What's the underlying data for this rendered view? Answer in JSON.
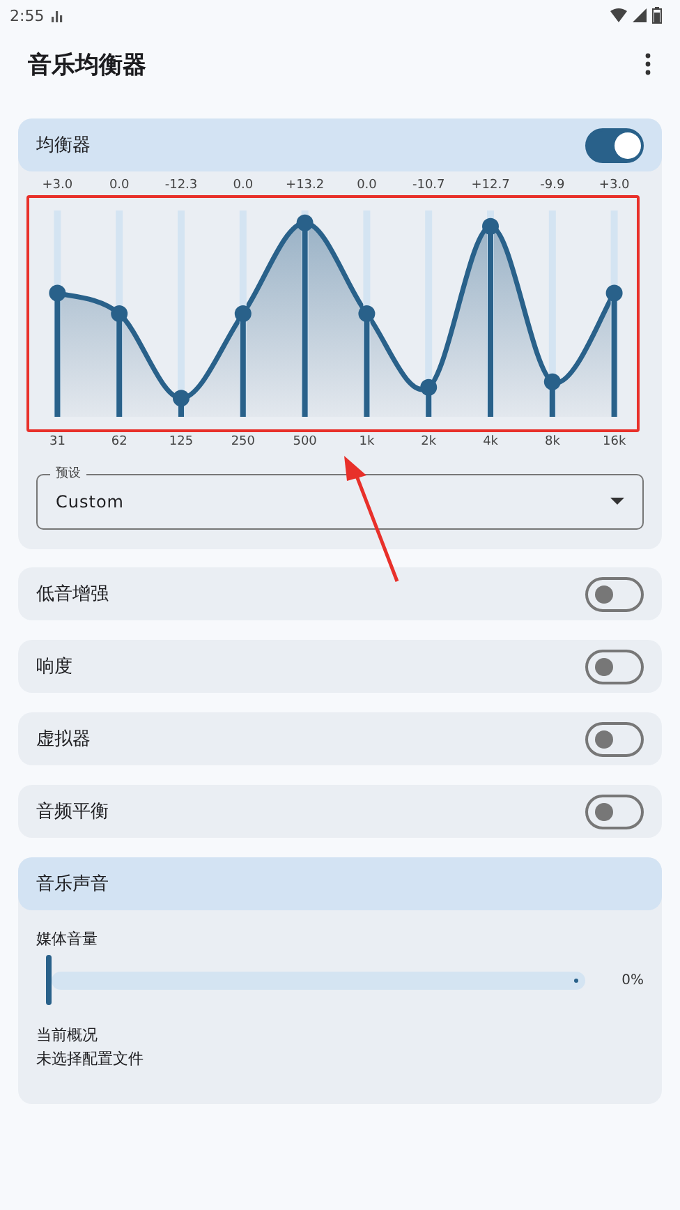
{
  "status_bar": {
    "time": "2:55"
  },
  "app_bar": {
    "title": "音乐均衡器"
  },
  "equalizer": {
    "title": "均衡器",
    "on": true,
    "bands": [
      {
        "label": "31",
        "reading": "+3.0",
        "level": 0.6
      },
      {
        "label": "62",
        "reading": "0.0",
        "level": 0.5
      },
      {
        "label": "125",
        "reading": "-12.3",
        "level": 0.09
      },
      {
        "label": "250",
        "reading": "0.0",
        "level": 0.5
      },
      {
        "label": "500",
        "reading": "+13.2",
        "level": 0.94
      },
      {
        "label": "1k",
        "reading": "0.0",
        "level": 0.5
      },
      {
        "label": "2k",
        "reading": "-10.7",
        "level": 0.143
      },
      {
        "label": "4k",
        "reading": "+12.7",
        "level": 0.923
      },
      {
        "label": "8k",
        "reading": "-9.9",
        "level": 0.17
      },
      {
        "label": "16k",
        "reading": "+3.0",
        "level": 0.6
      }
    ],
    "preset": {
      "label": "预设",
      "value": "Custom"
    }
  },
  "toggles": [
    {
      "label": "低音增强",
      "on": false
    },
    {
      "label": "响度",
      "on": false
    },
    {
      "label": "虚拟器",
      "on": false
    },
    {
      "label": "音频平衡",
      "on": false
    }
  ],
  "music_sound": {
    "title": "音乐声音",
    "volume": {
      "label": "媒体音量",
      "level": 0,
      "reading": "0%"
    },
    "profile": {
      "label": "当前概况",
      "value": "未选择配置文件"
    }
  }
}
